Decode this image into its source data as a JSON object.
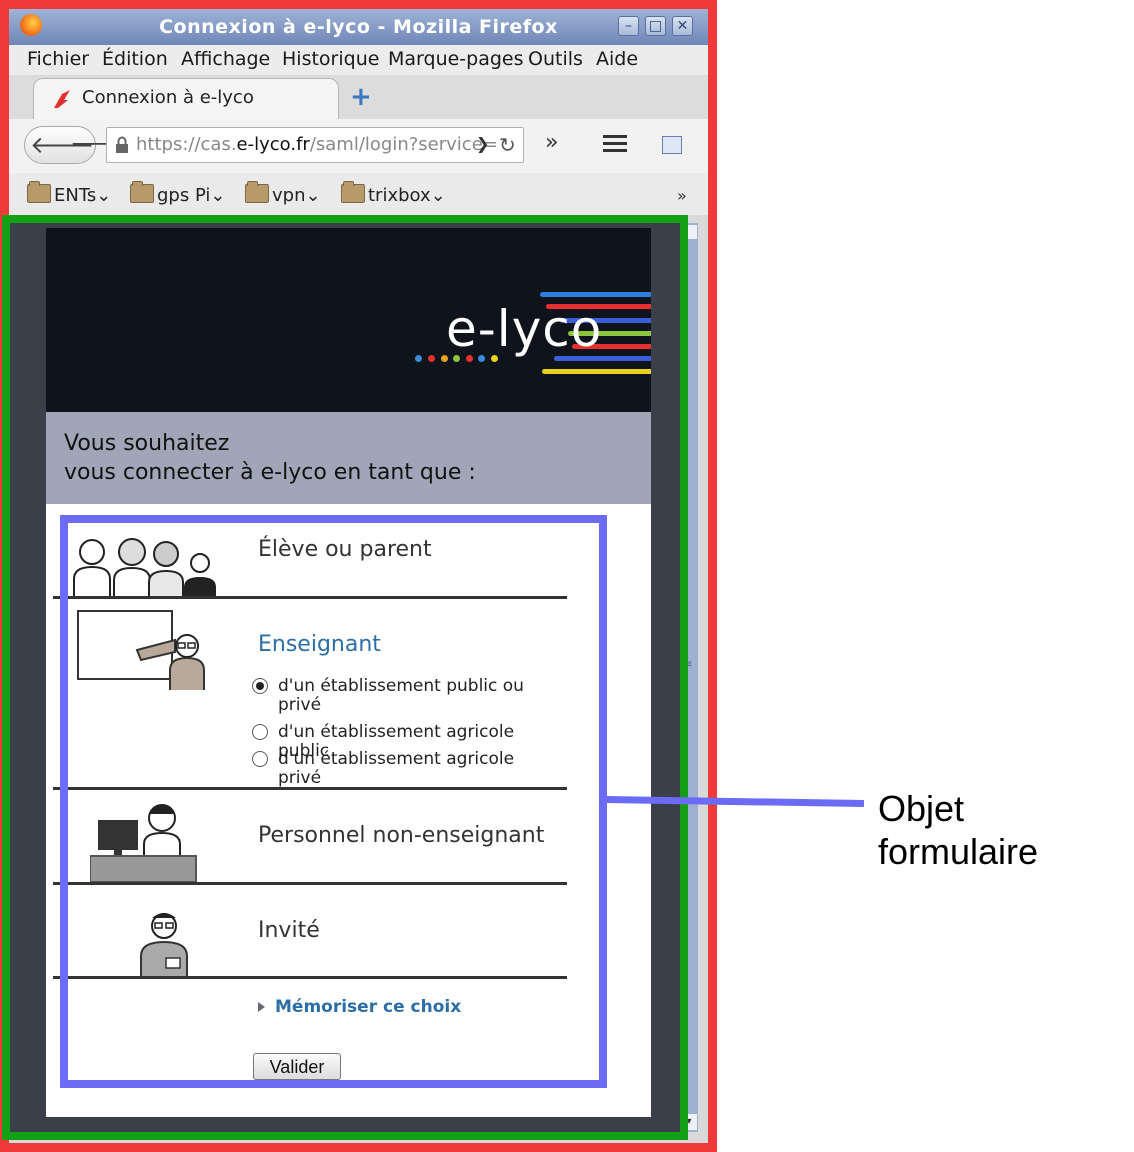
{
  "window": {
    "title": "Connexion à e-lyco - Mozilla Firefox"
  },
  "menu": [
    "Fichier",
    "Édition",
    "Affichage",
    "Historique",
    "Marque-pages",
    "Outils",
    "Aide"
  ],
  "tab": {
    "label": "Connexion à e-lyco"
  },
  "urlbar": {
    "prefix": "https://cas.",
    "domain": "e-lyco.fr",
    "suffix": "/saml/login?service="
  },
  "bookmarks": [
    "ENTs",
    "gps Pi",
    "vpn",
    "trixbox"
  ],
  "page": {
    "logo": "e-lyco",
    "prompt_line1": "Vous souhaitez",
    "prompt_line2": "vous connecter à e-lyco en tant que :",
    "roles": {
      "student": "Élève ou parent",
      "teacher": "Enseignant",
      "staff": "Personnel non-enseignant",
      "guest": "Invité"
    },
    "teacher_options": [
      {
        "label": "d'un établissement public ou privé",
        "checked": true
      },
      {
        "label": "d'un établissement agricole public",
        "checked": false
      },
      {
        "label": "d'un établissement agricole privé",
        "checked": false
      }
    ],
    "remember": "Mémoriser ce choix",
    "submit": "Valider"
  },
  "annotation": {
    "line1": "Objet",
    "line2": "formulaire"
  },
  "colors": {
    "outer_frame": "#f03a3a",
    "content_frame": "#14a014",
    "form_highlight": "#6b6bf5",
    "teacher_link": "#2c6ea6",
    "banner": "#0f131c",
    "prompt_band": "#a0a6b8"
  }
}
